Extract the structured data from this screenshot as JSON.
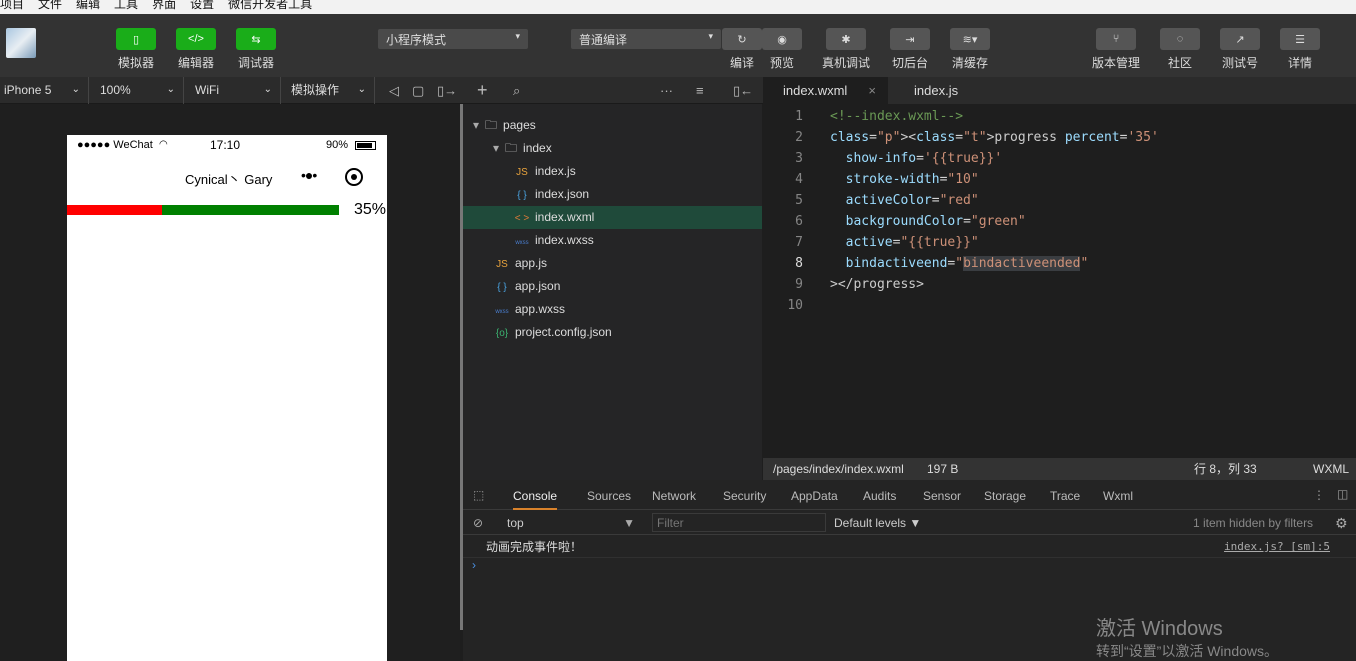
{
  "menu": [
    "项目",
    "文件",
    "编辑",
    "工具",
    "界面",
    "设置",
    "微信开发者工具"
  ],
  "toolbar": {
    "left_buttons": [
      {
        "label": "模拟器",
        "icon": "phone-icon",
        "glyph": "▯"
      },
      {
        "label": "编辑器",
        "icon": "code-icon",
        "glyph": "</>"
      },
      {
        "label": "调试器",
        "icon": "debug-icon",
        "glyph": "⇆"
      }
    ],
    "mode_select": "小程序模式",
    "compile_select": "普通编译",
    "mid_buttons": [
      {
        "label": "编译",
        "icon": "refresh-icon",
        "glyph": "↻"
      },
      {
        "label": "预览",
        "icon": "eye-icon",
        "glyph": "◉"
      },
      {
        "label": "真机调试",
        "icon": "bug-icon",
        "glyph": "✱"
      },
      {
        "label": "切后台",
        "icon": "background-icon",
        "glyph": "⇥"
      },
      {
        "label": "清缓存",
        "icon": "layers-icon",
        "glyph": "≋▾"
      }
    ],
    "right_buttons": [
      {
        "label": "版本管理",
        "icon": "branch-icon",
        "glyph": "⑂"
      },
      {
        "label": "社区",
        "icon": "chat-icon",
        "glyph": "◌"
      },
      {
        "label": "测试号",
        "icon": "external-link-icon",
        "glyph": "↗"
      },
      {
        "label": "详情",
        "icon": "menu-icon",
        "glyph": "☰"
      }
    ]
  },
  "simulator_bar": {
    "device": "iPhone 5",
    "zoom": "100%",
    "network": "WiFi",
    "operation": "模拟操作"
  },
  "phone": {
    "carrier": "●●●●● WeChat",
    "time": "17:10",
    "battery": "90%",
    "nav_title": "Cynical丶 Gary",
    "progress_percent": 35,
    "progress_label": "35%",
    "active_color": "#ff0000",
    "background_color": "#008000"
  },
  "file_tree": [
    {
      "name": "pages",
      "type": "folder",
      "depth": 0
    },
    {
      "name": "index",
      "type": "folder",
      "depth": 1
    },
    {
      "name": "index.js",
      "type": "js",
      "depth": 2
    },
    {
      "name": "index.json",
      "type": "json",
      "depth": 2
    },
    {
      "name": "index.wxml",
      "type": "wxml",
      "depth": 2,
      "active": true
    },
    {
      "name": "index.wxss",
      "type": "wxss",
      "depth": 2
    },
    {
      "name": "app.js",
      "type": "js",
      "depth": 1
    },
    {
      "name": "app.json",
      "type": "json",
      "depth": 1
    },
    {
      "name": "app.wxss",
      "type": "wxss",
      "depth": 1
    },
    {
      "name": "project.config.json",
      "type": "config",
      "depth": 1
    }
  ],
  "editor_tabs": [
    {
      "label": "index.wxml",
      "active": true
    },
    {
      "label": "index.js",
      "active": false
    }
  ],
  "code_lines": [
    "<!--index.wxml-->",
    "<progress percent='35'",
    "  show-info='{{true}}'",
    "  stroke-width=\"10\"",
    "  activeColor=\"red\"",
    "  backgroundColor=\"green\"",
    "  active=\"{{true}}\"",
    "  bindactiveend=\"bindactiveended\"",
    "></progress>",
    ""
  ],
  "status": {
    "path": "/pages/index/index.wxml",
    "size": "197 B",
    "position": "行 8，列 33",
    "language": "WXML"
  },
  "devtools": {
    "tabs": [
      "Console",
      "Sources",
      "Network",
      "Security",
      "AppData",
      "Audits",
      "Sensor",
      "Storage",
      "Trace",
      "Wxml"
    ],
    "context": "top",
    "filter_placeholder": "Filter",
    "levels": "Default levels",
    "hidden": "1 item hidden by filters",
    "log_message": "动画完成事件啦！",
    "log_source": "index.js? [sm]:5"
  },
  "watermark": {
    "line1": "激活 Windows",
    "line2": "转到“设置”以激活 Windows。"
  }
}
